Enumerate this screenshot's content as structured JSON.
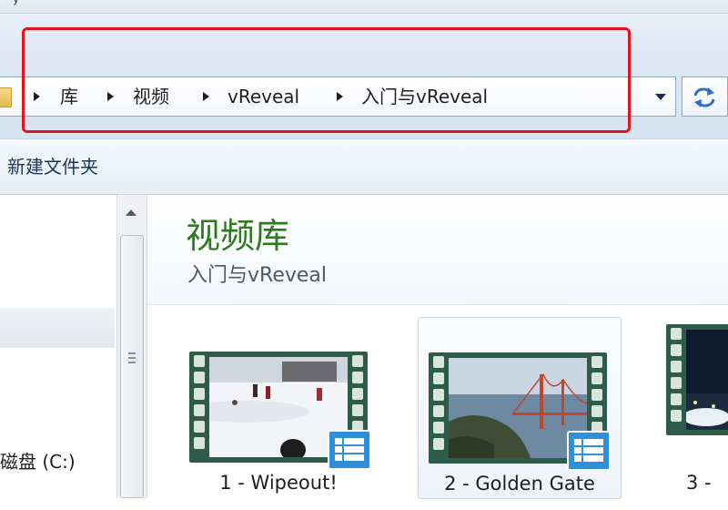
{
  "window": {
    "title_fragment": "y"
  },
  "address_bar": {
    "breadcrumbs": [
      "库",
      "视频",
      "vReveal",
      "入门与vReveal"
    ],
    "dropdown_icon": "chevron-down-icon",
    "refresh_icon": "refresh-icon"
  },
  "toolbar": {
    "new_folder_label": "新建文件夹"
  },
  "nav_pane": {
    "drive_label": "磁盘 (C:)",
    "partial_label": "……"
  },
  "library": {
    "title": "视频库",
    "subtitle": "入门与vReveal"
  },
  "videos": [
    {
      "label": "1 - Wipeout!"
    },
    {
      "label": "2 - Golden Gate"
    },
    {
      "label": "3 -"
    }
  ],
  "colors": {
    "highlight": "#e8121b",
    "library_title": "#2f7a1f",
    "badge": "#2f8fd7",
    "film": "#2f5c4a"
  }
}
